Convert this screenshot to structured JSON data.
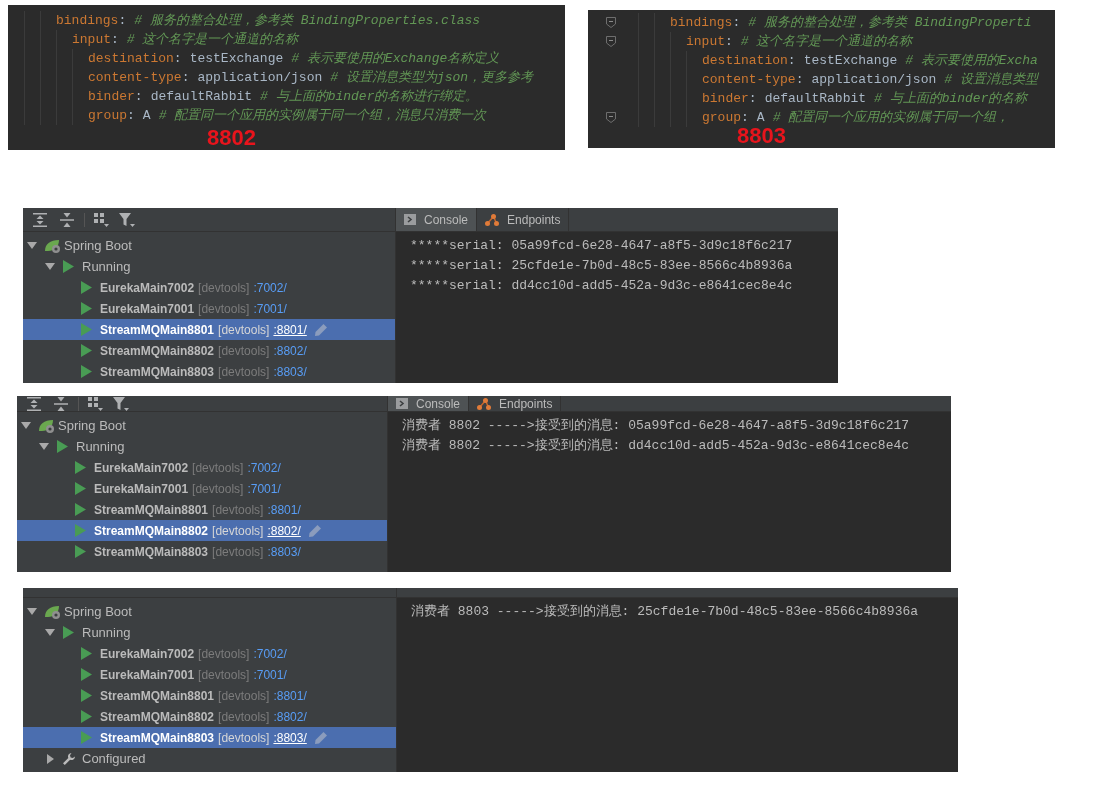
{
  "yaml_panels": [
    {
      "label": "8802",
      "lines": [
        {
          "key": "bindings",
          "colon": ":",
          "comment": "# 服务的整合处理，参考类 BindingProperties.class",
          "fold_marker": false,
          "children": [
            {
              "key": "input",
              "colon": ":",
              "comment": "# 这个名字是一个通道的名称",
              "fold_marker": false,
              "children": [
                {
                  "key": "destination",
                  "colon": ":",
                  "value": "testExchange",
                  "comment": "# 表示要使用的Exchange名称定义",
                  "fold_marker": false
                },
                {
                  "key": "content-type",
                  "colon": ":",
                  "value": "application/json",
                  "comment": "# 设置消息类型为json，更多参考",
                  "fold_marker": false
                },
                {
                  "key": "binder",
                  "colon": ":",
                  "value": "defaultRabbit",
                  "comment": "# 与上面的binder的名称进行绑定。",
                  "fold_marker": false
                },
                {
                  "key": "group",
                  "colon": ":",
                  "value": "A",
                  "comment": "# 配置同一个应用的实例属于同一个组，消息只消费一次",
                  "fold_marker": false
                }
              ]
            }
          ]
        }
      ]
    },
    {
      "label": "8803",
      "lines": [
        {
          "key": "bindings",
          "colon": ":",
          "comment": "# 服务的整合处理，参考类 BindingProperti",
          "fold_marker": true,
          "children": [
            {
              "key": "input",
              "colon": ":",
              "comment": "# 这个名字是一个通道的名称",
              "fold_marker": true,
              "children": [
                {
                  "key": "destination",
                  "colon": ":",
                  "value": "testExchange",
                  "comment": "# 表示要使用的Excha",
                  "fold_marker": false
                },
                {
                  "key": "content-type",
                  "colon": ":",
                  "value": "application/json",
                  "comment": "# 设置消息类型",
                  "fold_marker": false
                },
                {
                  "key": "binder",
                  "colon": ":",
                  "value": "defaultRabbit",
                  "comment": "# 与上面的binder的名称",
                  "fold_marker": false
                },
                {
                  "key": "group",
                  "colon": ":",
                  "value": "A",
                  "comment": "# 配置同一个应用的实例属于同一个组，",
                  "fold_marker": true
                }
              ]
            }
          ]
        }
      ]
    }
  ],
  "run_panels": [
    {
      "tabs": [
        {
          "kind": "console",
          "label": "Console",
          "selected": true
        },
        {
          "kind": "endpoints",
          "label": "Endpoints",
          "selected": false
        }
      ],
      "tree": [
        {
          "kind": "root",
          "label": "Spring Boot",
          "expanded": true,
          "children": [
            {
              "kind": "status",
              "label": "Running",
              "expanded": true,
              "children": [
                {
                  "kind": "app",
                  "name": "EurekaMain7002",
                  "tag": "[devtools]",
                  "port": ":7002/",
                  "selected": false
                },
                {
                  "kind": "app",
                  "name": "EurekaMain7001",
                  "tag": "[devtools]",
                  "port": ":7001/",
                  "selected": false
                },
                {
                  "kind": "app",
                  "name": "StreamMQMain8801",
                  "tag": "[devtools]",
                  "port": ":8801/",
                  "selected": true
                },
                {
                  "kind": "app",
                  "name": "StreamMQMain8802",
                  "tag": "[devtools]",
                  "port": ":8802/",
                  "selected": false
                },
                {
                  "kind": "app",
                  "name": "StreamMQMain8803",
                  "tag": "[devtools]",
                  "port": ":8803/",
                  "selected": false
                }
              ]
            }
          ]
        }
      ],
      "console": [
        "*****serial: 05a99fcd-6e28-4647-a8f5-3d9c18f6c217",
        "*****serial: 25cfde1e-7b0d-48c5-83ee-8566c4b8936a",
        "*****serial: dd4cc10d-add5-452a-9d3c-e8641cec8e4c"
      ]
    },
    {
      "tabs": [
        {
          "kind": "console",
          "label": "Console",
          "selected": true
        },
        {
          "kind": "endpoints",
          "label": "Endpoints",
          "selected": false
        }
      ],
      "tree": [
        {
          "kind": "root",
          "label": "Spring Boot",
          "expanded": true,
          "children": [
            {
              "kind": "status",
              "label": "Running",
              "expanded": true,
              "children": [
                {
                  "kind": "app",
                  "name": "EurekaMain7002",
                  "tag": "[devtools]",
                  "port": ":7002/",
                  "selected": false
                },
                {
                  "kind": "app",
                  "name": "EurekaMain7001",
                  "tag": "[devtools]",
                  "port": ":7001/",
                  "selected": false
                },
                {
                  "kind": "app",
                  "name": "StreamMQMain8801",
                  "tag": "[devtools]",
                  "port": ":8801/",
                  "selected": false
                },
                {
                  "kind": "app",
                  "name": "StreamMQMain8802",
                  "tag": "[devtools]",
                  "port": ":8802/",
                  "selected": true
                },
                {
                  "kind": "app",
                  "name": "StreamMQMain8803",
                  "tag": "[devtools]",
                  "port": ":8803/",
                  "selected": false
                }
              ]
            }
          ]
        }
      ],
      "console": [
        "消费者 8802 ----->接受到的消息: 05a99fcd-6e28-4647-a8f5-3d9c18f6c217",
        "消费者 8802 ----->接受到的消息: dd4cc10d-add5-452a-9d3c-e8641cec8e4c"
      ]
    },
    {
      "tree": [
        {
          "kind": "root",
          "label": "Spring Boot",
          "expanded": true,
          "children": [
            {
              "kind": "status",
              "label": "Running",
              "expanded": true,
              "children": [
                {
                  "kind": "app",
                  "name": "EurekaMain7002",
                  "tag": "[devtools]",
                  "port": ":7002/",
                  "selected": false
                },
                {
                  "kind": "app",
                  "name": "EurekaMain7001",
                  "tag": "[devtools]",
                  "port": ":7001/",
                  "selected": false
                },
                {
                  "kind": "app",
                  "name": "StreamMQMain8801",
                  "tag": "[devtools]",
                  "port": ":8801/",
                  "selected": false
                },
                {
                  "kind": "app",
                  "name": "StreamMQMain8802",
                  "tag": "[devtools]",
                  "port": ":8802/",
                  "selected": false
                },
                {
                  "kind": "app",
                  "name": "StreamMQMain8803",
                  "tag": "[devtools]",
                  "port": ":8803/",
                  "selected": true
                }
              ]
            },
            {
              "kind": "config",
              "label": "Configured",
              "expanded": false
            }
          ]
        }
      ],
      "console": [
        "消费者 8803 ----->接受到的消息: 25cfde1e-7b0d-48c5-83ee-8566c4b8936a"
      ]
    }
  ]
}
